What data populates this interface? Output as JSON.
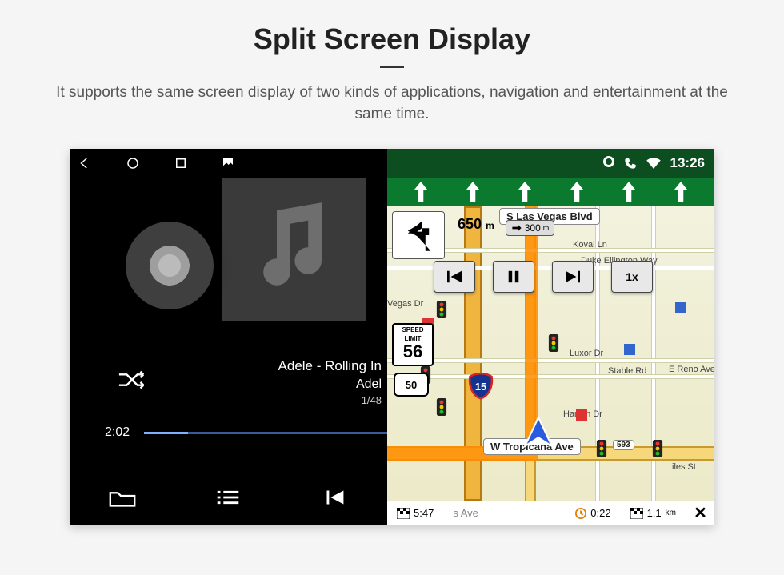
{
  "heading": {
    "title": "Split Screen Display",
    "subtitle": "It supports the same screen display of two kinds of applications, navigation and entertainment at the same time."
  },
  "status": {
    "time": "13:26"
  },
  "media": {
    "track_title": "Adele - Rolling In",
    "track_artist": "Adel",
    "track_index": "1/48",
    "elapsed": "2:02"
  },
  "nav": {
    "current_turn_distance": "650",
    "current_turn_unit": "m",
    "next_turn_distance": "300",
    "next_turn_unit": "m",
    "speed_limit_label_top": "SPEED",
    "speed_limit_label_bottom": "LIMIT",
    "speed_limit_value": "56",
    "route_shield": "50",
    "interstate_shield": "15",
    "speed_multiplier": "1x",
    "streets": {
      "las_vegas_blvd": "S Las Vegas Blvd",
      "koval_ln": "Koval Ln",
      "duke_ellington": "Duke Ellington Way",
      "vegas_dr": "Vegas Dr",
      "luxor_dr": "Luxor Dr",
      "stable_rd": "Stable Rd",
      "reno_ave": "E Reno Ave",
      "hamlin_dr": "Hamlin Dr",
      "tropicana": "W Tropicana Ave",
      "giles_st": "iles St",
      "tropicana_exit": "593",
      "sinas_ave": "s Ave"
    },
    "footer": {
      "eta": "5:47",
      "drive_time": "0:22",
      "remaining_dist": "1.1",
      "remaining_unit": "km"
    }
  }
}
